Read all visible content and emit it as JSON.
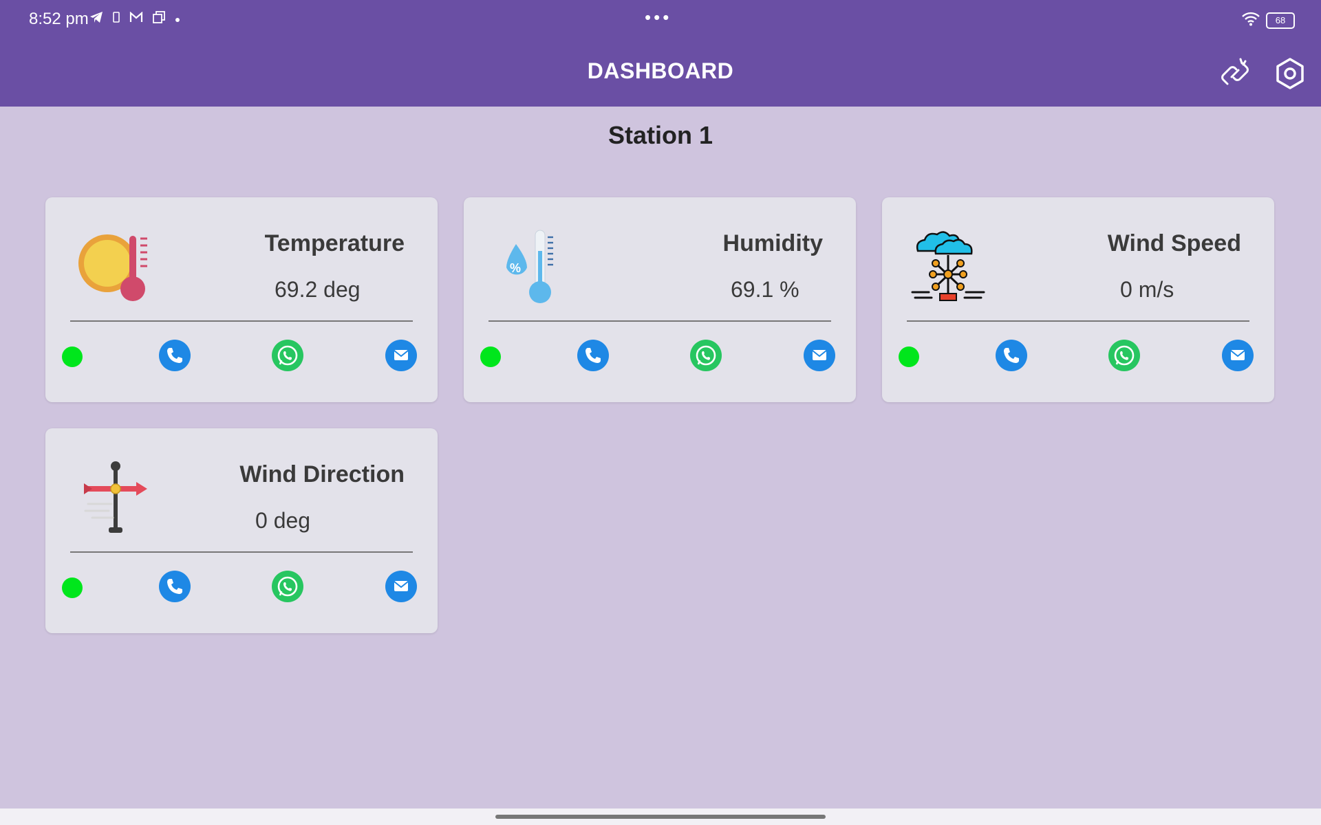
{
  "status_bar": {
    "time": "8:52 pm",
    "battery": "68",
    "icons": [
      "telegram-icon",
      "sim-icon",
      "gmail-icon",
      "copy-icon",
      "dot-icon",
      "wifi-icon",
      "battery-icon"
    ]
  },
  "app_bar": {
    "title": "DASHBOARD",
    "actions": [
      "link-off-icon",
      "settings-icon"
    ]
  },
  "station_title": "Station 1",
  "cards": [
    {
      "title": "Temperature",
      "value": "69.2 deg",
      "icon": "sun-thermometer-icon",
      "status_color": "#00e61c"
    },
    {
      "title": "Humidity",
      "value": "69.1 %",
      "icon": "humidity-thermometer-icon",
      "status_color": "#00e61c"
    },
    {
      "title": "Wind Speed",
      "value": "0 m/s",
      "icon": "wind-station-icon",
      "status_color": "#00e61c"
    },
    {
      "title": "Wind Direction",
      "value": "0 deg",
      "icon": "weather-vane-icon",
      "status_color": "#00e61c"
    }
  ],
  "colors": {
    "app_bar": "#6a4fa4",
    "background": "#cfc4de",
    "card": "#e3e2ea",
    "status_ok": "#00e61c",
    "call": "#1e88e5",
    "whatsapp": "#27c660",
    "mail": "#1e88e5"
  }
}
